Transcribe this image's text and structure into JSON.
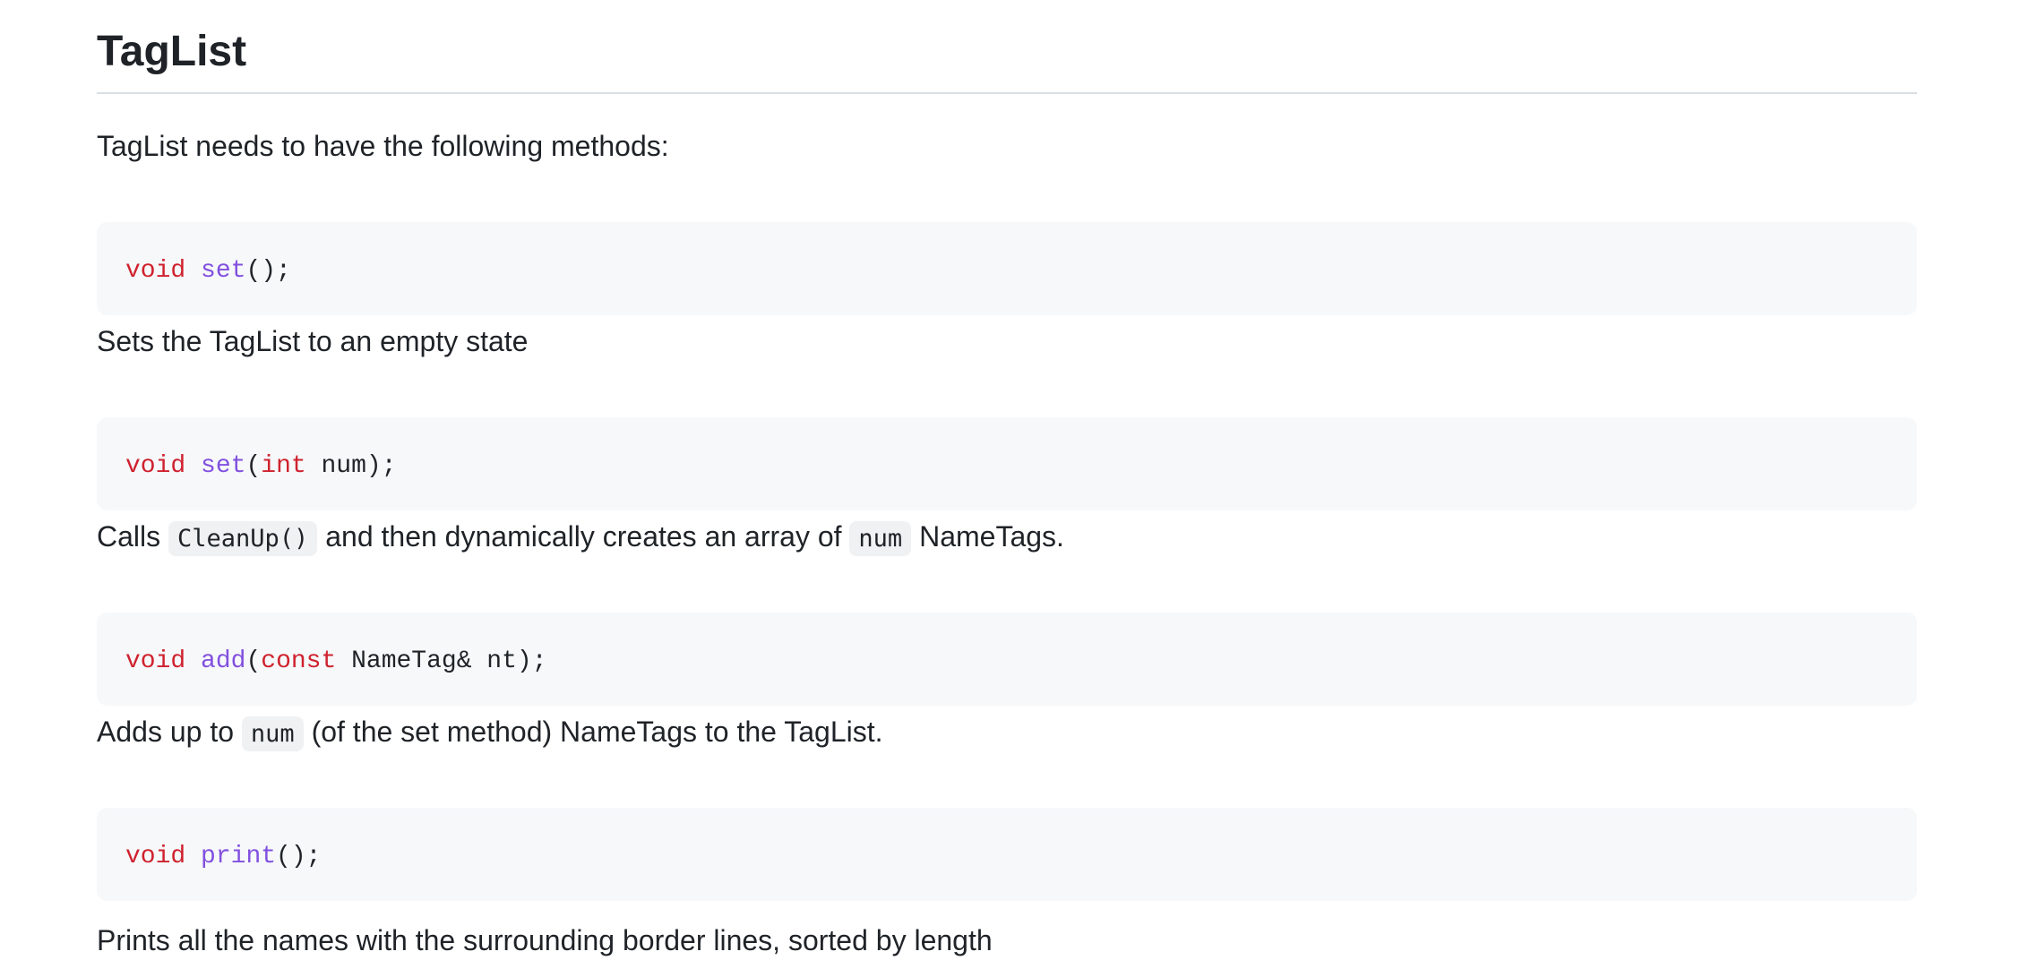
{
  "heading": "TagList",
  "intro": "TagList needs to have the following methods:",
  "methods": [
    {
      "tokens": [
        {
          "t": "void",
          "c": "kw"
        },
        {
          "t": " ",
          "c": "pl"
        },
        {
          "t": "set",
          "c": "fn"
        },
        {
          "t": "();",
          "c": "pl"
        }
      ],
      "description": [
        {
          "t": "Sets the TagList to an empty state",
          "code": false
        }
      ]
    },
    {
      "tokens": [
        {
          "t": "void",
          "c": "kw"
        },
        {
          "t": " ",
          "c": "pl"
        },
        {
          "t": "set",
          "c": "fn"
        },
        {
          "t": "(",
          "c": "pl"
        },
        {
          "t": "int",
          "c": "kw"
        },
        {
          "t": " num);",
          "c": "pl"
        }
      ],
      "description": [
        {
          "t": "Calls ",
          "code": false
        },
        {
          "t": "CleanUp()",
          "code": true
        },
        {
          "t": " and then dynamically creates an array of ",
          "code": false
        },
        {
          "t": "num",
          "code": true
        },
        {
          "t": " NameTags.",
          "code": false
        }
      ]
    },
    {
      "tokens": [
        {
          "t": "void",
          "c": "kw"
        },
        {
          "t": " ",
          "c": "pl"
        },
        {
          "t": "add",
          "c": "fn"
        },
        {
          "t": "(",
          "c": "pl"
        },
        {
          "t": "const",
          "c": "kw"
        },
        {
          "t": " NameTag& nt);",
          "c": "pl"
        }
      ],
      "description": [
        {
          "t": "Adds up to ",
          "code": false
        },
        {
          "t": "num",
          "code": true
        },
        {
          "t": " (of the set method) NameTags to the TagList.",
          "code": false
        }
      ]
    },
    {
      "tokens": [
        {
          "t": "void",
          "c": "kw"
        },
        {
          "t": " ",
          "c": "pl"
        },
        {
          "t": "print",
          "c": "fn"
        },
        {
          "t": "();",
          "c": "pl"
        }
      ],
      "description": [
        {
          "t": "Prints all the names with the surrounding border lines, sorted by length",
          "code": false
        }
      ]
    }
  ],
  "colors": {
    "keyword": "#cf222e",
    "function": "#8250df",
    "text": "#1f2328",
    "code_background": "#f6f8fa"
  }
}
